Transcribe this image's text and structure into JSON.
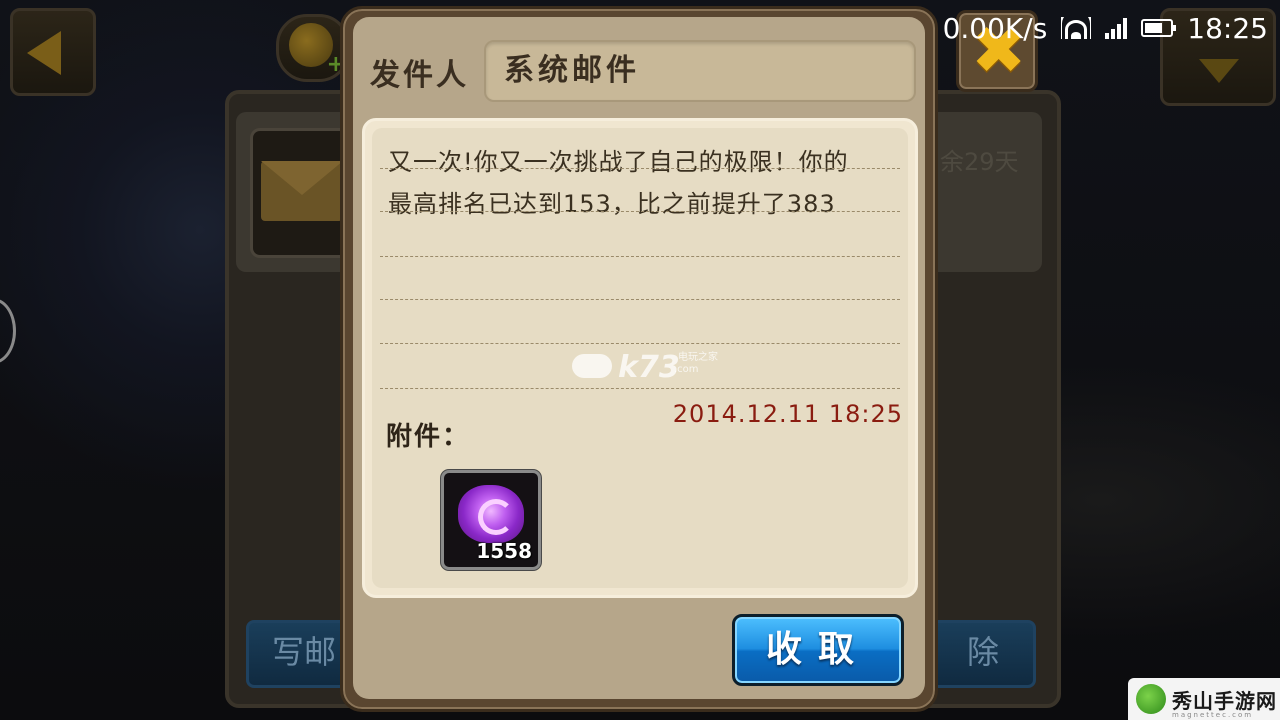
{
  "status_bar": {
    "network_speed": "0.00K/s",
    "time": "18:25",
    "icons": [
      "wifi-icon",
      "signal-icon",
      "battery-icon"
    ]
  },
  "background": {
    "remaining_text": "余29天",
    "write_button_label": "写邮",
    "delete_button_label": "除",
    "icons": [
      "back-arrow-icon",
      "gold-coin-plus-icon",
      "envelope-icon",
      "chevron-down-icon"
    ]
  },
  "mail_dialog": {
    "sender_label": "发件人",
    "sender_value": "系统邮件",
    "message_lines": [
      "又一次!你又一次挑战了自己的极限！你的",
      "最高排名已达到153，比之前提升了383"
    ],
    "date": "2014.12.11  18:25",
    "attachment_label": "附件：",
    "attachment": {
      "icon": "purple-gem-icon",
      "count": "1558"
    },
    "collect_button": "收取",
    "close_icon": "close-x-icon"
  },
  "watermark": {
    "text": "k73",
    "small_text": "电玩之家",
    "domain": ".com"
  },
  "corner_logo": {
    "text": "秀山手游网",
    "sub": "magnettec.com"
  },
  "colors": {
    "date": "#8a1c10",
    "collect_button": "#1e8ee0",
    "close_x": "#f0b81a",
    "dialog_frame": "#5a4630",
    "paper": "#e6dcc4"
  }
}
